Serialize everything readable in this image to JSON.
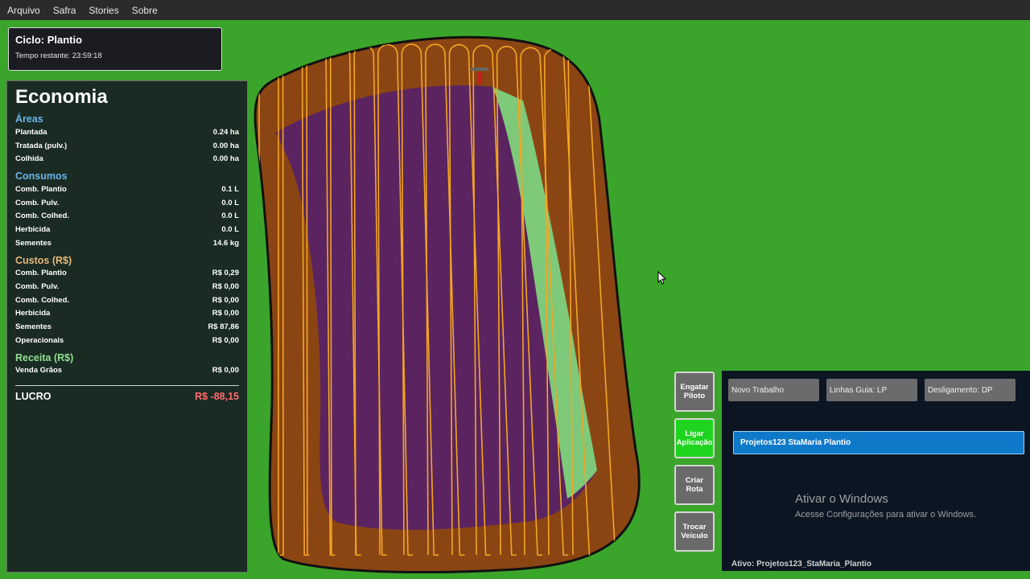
{
  "menu": [
    "Arquivo",
    "Safra",
    "Stories",
    "Sobre"
  ],
  "cycle": {
    "title": "Ciclo: Plantio",
    "time": "Tempo restante: 23:59:18"
  },
  "economy": {
    "title": "Economia",
    "areas": {
      "title": "Áreas",
      "rows": [
        {
          "label": "Plantada",
          "value": "0.24 ha"
        },
        {
          "label": "Tratada (pulv.)",
          "value": "0.00 ha"
        },
        {
          "label": "Colhida",
          "value": "0.00 ha"
        }
      ]
    },
    "consumos": {
      "title": "Consumos",
      "rows": [
        {
          "label": "Comb. Plantio",
          "value": "0.1 L"
        },
        {
          "label": "Comb. Pulv.",
          "value": "0.0 L"
        },
        {
          "label": "Comb. Colhed.",
          "value": "0.0 L"
        },
        {
          "label": "Herbicida",
          "value": "0.0 L"
        },
        {
          "label": "Sementes",
          "value": "14.6 kg"
        }
      ]
    },
    "custos": {
      "title": "Custos (R$)",
      "rows": [
        {
          "label": "Comb. Plantio",
          "value": "R$ 0,29"
        },
        {
          "label": "Comb. Pulv.",
          "value": "R$ 0,00"
        },
        {
          "label": "Comb. Colhed.",
          "value": "R$ 0,00"
        },
        {
          "label": "Herbicida",
          "value": "R$ 0,00"
        },
        {
          "label": "Sementes",
          "value": "R$ 87,86"
        },
        {
          "label": "Operacionais",
          "value": "R$ 0,00"
        }
      ]
    },
    "receita": {
      "title": "Receita (R$)",
      "rows": [
        {
          "label": "Venda Grãos",
          "value": "R$ 0,00"
        }
      ]
    },
    "profit": {
      "label": "LUCRO",
      "value": "R$ -88,15"
    }
  },
  "side_buttons": [
    "Engatar Piloto",
    "Ligar Aplicação",
    "Criar Rota",
    "Trocar Veículo"
  ],
  "toolbar": {
    "new_job": "Novo Trabalho",
    "guide_lines": "Linhas Guia: LP",
    "shutdown": "Desligamento: DP"
  },
  "jobs": [
    "Projetos123 StaMaria Plantio"
  ],
  "status": "Ativo: Projetos123_StaMaria_Plantio",
  "watermark": {
    "title": "Ativar o Windows",
    "subtitle": "Acesse Configurações para ativar o Windows."
  },
  "colors": {
    "grass": "#3aa52a",
    "soil": "#8b4513",
    "planted": "#5b2460",
    "sprayed": "#7ec97a",
    "guide": "#f5a623"
  },
  "icons": [
    "tractor-icon",
    "cursor-icon"
  ]
}
